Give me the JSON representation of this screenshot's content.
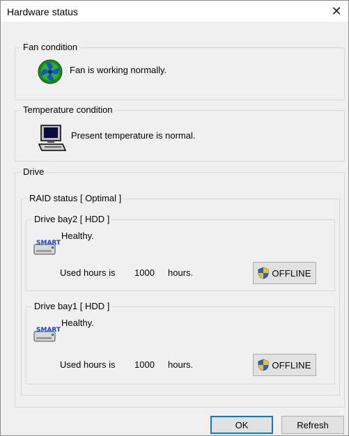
{
  "window": {
    "title": "Hardware status",
    "close_glyph": "✕"
  },
  "fan": {
    "group_label": "Fan condition",
    "icon": "fan-icon",
    "status": "Fan is working normally."
  },
  "temperature": {
    "group_label": "Temperature condition",
    "icon": "computer-icon",
    "status": "Present temperature is normal."
  },
  "drive": {
    "group_label": "Drive",
    "raid": {
      "label": "RAID status [ Optimal ]",
      "bays": [
        {
          "label": "Drive bay2 [ HDD ]",
          "health": "Healthy.",
          "icon_text": "SMART",
          "used_prefix": "Used hours is",
          "used_value": "1000",
          "used_unit": "hours.",
          "offline_label": "OFFLINE"
        },
        {
          "label": "Drive bay1 [ HDD ]",
          "health": "Healthy.",
          "icon_text": "SMART",
          "used_prefix": "Used hours is",
          "used_value": "1000",
          "used_unit": "hours.",
          "offline_label": "OFFLINE"
        }
      ]
    }
  },
  "buttons": {
    "ok": "OK",
    "refresh": "Refresh"
  },
  "colors": {
    "accent": "#0078d7",
    "window_bg": "#f0f0f0",
    "group_border": "#d7d7d7"
  }
}
